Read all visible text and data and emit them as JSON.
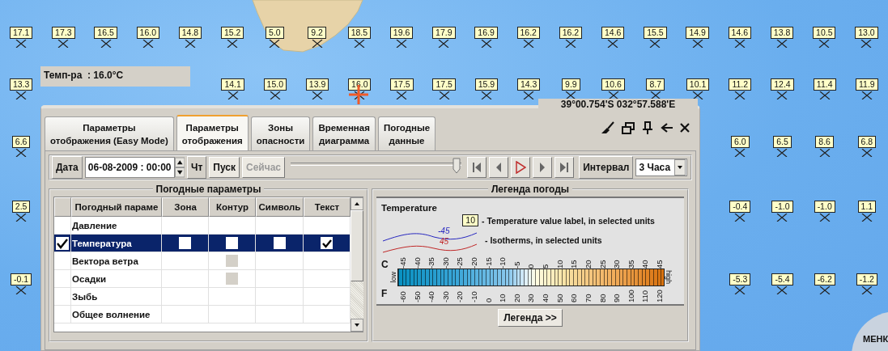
{
  "map": {
    "station_rows": [
      {
        "west": [
          "17.1",
          "17.3",
          "16.5",
          "16.0",
          "14.8",
          "15.2",
          "5.0",
          "9.2",
          "18.5",
          "19.6",
          "17.9",
          "16.9",
          "16.2",
          "16.2",
          "14.6",
          "15.5",
          "14.9",
          "14.6",
          "13.8",
          "10.5",
          "13.0"
        ]
      },
      {
        "west": [
          "13.3"
        ],
        "east": [
          "14.1",
          "15.0",
          "13.9",
          "16.0",
          "17.5",
          "17.5",
          "15.9",
          "14.3",
          "9.9",
          "10.6",
          "8.7",
          "10.1",
          "11.2",
          "12.4",
          "11.4",
          "11.9"
        ]
      },
      {
        "west": [
          "6.6"
        ],
        "east": [
          "6.0",
          "6.5",
          "8.6",
          "6.8"
        ]
      },
      {
        "west": [
          "2.5"
        ],
        "east": [
          "-0.4",
          "-1.0",
          "-1.0",
          "1.1"
        ]
      },
      {
        "west": [
          "-0.1"
        ],
        "east": [
          "-5.3",
          "-5.4",
          "-6.2",
          "-1.2"
        ]
      }
    ],
    "tooltip": "Темп-ра  : 16.0°C",
    "coordinates": "39°00.754'S 032°57.588'E",
    "corner_label": "МЕНК"
  },
  "dialog": {
    "tabs": [
      {
        "label": "Параметры\nотображения (Easy Mode)",
        "selected": false
      },
      {
        "label": "Параметры\nотображения",
        "selected": true
      },
      {
        "label": "Зоны\nопасности",
        "selected": false
      },
      {
        "label": "Временная\nдиаграмма",
        "selected": false
      },
      {
        "label": "Погодные\nданные",
        "selected": false
      }
    ],
    "toolbar": {
      "date_label": "Дата",
      "date_value": "06-08-2009 : 00:00",
      "weekday": "Чт",
      "start_button": {
        "label": "Пуск",
        "disabled": false
      },
      "now_button": {
        "label": "Сейчас",
        "disabled": true
      },
      "time_slider": {
        "level": 0.97
      },
      "playback_buttons": [
        {
          "kind": "first"
        },
        {
          "kind": "prev"
        },
        {
          "kind": "play"
        },
        {
          "kind": "next"
        },
        {
          "kind": "last"
        }
      ],
      "interval_label": "Интервал",
      "interval_value": "3 Часа"
    },
    "weather_parameters": {
      "title": "Погодные параметры",
      "columns": [
        "Погодный параме",
        "Зона",
        "Контур",
        "Символь",
        "Текст"
      ],
      "rows": [
        {
          "name": "Давление",
          "selected": false,
          "checked": false,
          "cells": [
            {
              "kind": "empty"
            },
            {
              "kind": "empty"
            },
            {
              "kind": "empty"
            },
            {
              "kind": "empty"
            }
          ]
        },
        {
          "name": "Температура",
          "selected": true,
          "checked": true,
          "cells": [
            {
              "kind": "checkbox",
              "checked": false
            },
            {
              "kind": "checkbox",
              "checked": false
            },
            {
              "kind": "checkbox",
              "checked": false
            },
            {
              "kind": "checkbox",
              "checked": true
            }
          ]
        },
        {
          "name": "Вектора ветра",
          "selected": false,
          "checked": false,
          "cells": [
            {
              "kind": "empty"
            },
            {
              "kind": "disabled"
            },
            {
              "kind": "empty"
            },
            {
              "kind": "empty"
            }
          ]
        },
        {
          "name": "Осадки",
          "selected": false,
          "checked": false,
          "cells": [
            {
              "kind": "empty"
            },
            {
              "kind": "disabled"
            },
            {
              "kind": "empty"
            },
            {
              "kind": "empty"
            }
          ]
        },
        {
          "name": "Зыбь",
          "selected": false,
          "checked": false,
          "cells": [
            {
              "kind": "empty"
            },
            {
              "kind": "empty"
            },
            {
              "kind": "empty"
            },
            {
              "kind": "empty"
            }
          ]
        },
        {
          "name": "Общее волнение",
          "selected": false,
          "checked": false,
          "cells": [
            {
              "kind": "empty"
            },
            {
              "kind": "empty"
            },
            {
              "kind": "empty"
            },
            {
              "kind": "empty"
            }
          ]
        }
      ]
    },
    "legend": {
      "title": "Легенда погоды",
      "section": "Temperature",
      "items": [
        {
          "kind": "value-label",
          "samples": [
            "10"
          ],
          "text": "- Temperature value label, in selected units"
        },
        {
          "kind": "isotherms",
          "samples": [
            "-45",
            "45"
          ],
          "text": "- Isotherms, in selected units"
        }
      ],
      "celsius_label": "C",
      "fahrenheit_label": "F",
      "low_label": "low",
      "high_label": "high",
      "celsius_ticks": [
        "-45",
        "-40",
        "-35",
        "-30",
        "-25",
        "-20",
        "-15",
        "-10",
        "-5",
        "0",
        "5",
        "10",
        "15",
        "20",
        "25",
        "30",
        "35",
        "40",
        "45"
      ],
      "fahrenheit_ticks": [
        "-60",
        "-50",
        "-40",
        "-30",
        "-20",
        "-10",
        "0",
        "10",
        "20",
        "30",
        "40",
        "50",
        "60",
        "70",
        "80",
        "90",
        "100",
        "110",
        "120"
      ],
      "button": "Легенда >>"
    }
  }
}
